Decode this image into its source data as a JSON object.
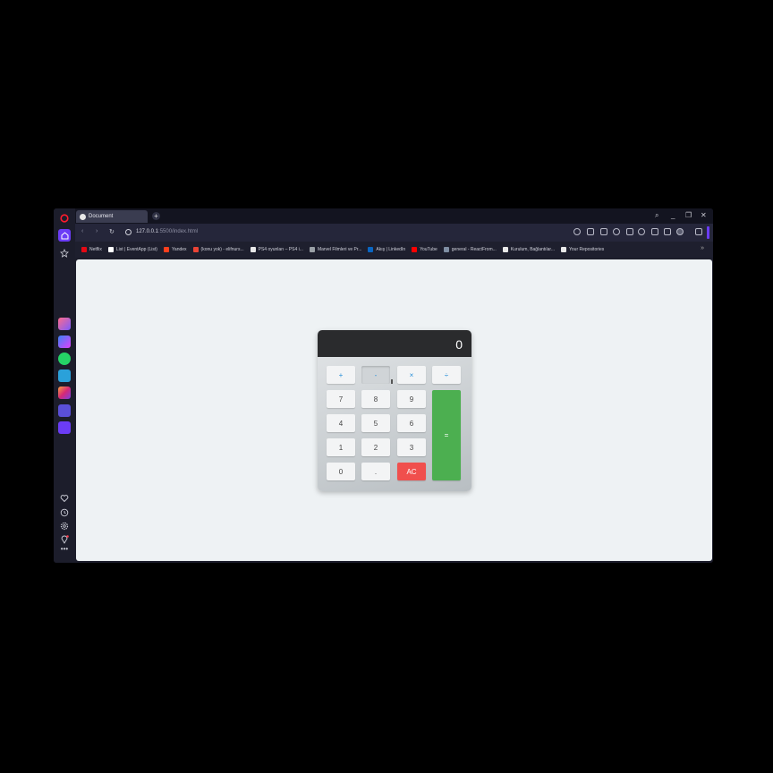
{
  "tab": {
    "title": "Document",
    "new_tab": "+"
  },
  "address": {
    "host": "127.0.0.1",
    "rest": ":5500/index.html"
  },
  "window_controls": {
    "search": "⌕",
    "minimize": "_",
    "restore": "❐",
    "close": "✕"
  },
  "nav": {
    "back": "‹",
    "forward": "›",
    "reload": "↻"
  },
  "bookmarks": [
    {
      "label": "Netflix",
      "color": "#e50914"
    },
    {
      "label": "List | EventApp (List)",
      "color": "#ffffff"
    },
    {
      "label": "Yandex",
      "color": "#fc3f1d"
    },
    {
      "label": "(konu yok) - elifnurs...",
      "color": "#ea4335"
    },
    {
      "label": "PS4 oyunları – PS4 i...",
      "color": "#e8e8e8"
    },
    {
      "label": "Marvel Filmleri ve Pr...",
      "color": "#9aa0a6"
    },
    {
      "label": "Akış | LinkedIn",
      "color": "#0a66c2"
    },
    {
      "label": "YouTube",
      "color": "#ff0000"
    },
    {
      "label": "general - ReactFrom...",
      "color": "#7f8ea3"
    },
    {
      "label": "Kurulum, Bağlantılar...",
      "color": "#e8e8e8"
    },
    {
      "label": "Your Repositories",
      "color": "#e8e8e8"
    }
  ],
  "bookmarks_more": "»",
  "calculator": {
    "display": "0",
    "ops": [
      "+",
      "-",
      "×",
      "÷"
    ],
    "digits": [
      "7",
      "8",
      "9",
      "4",
      "5",
      "6",
      "1",
      "2",
      "3",
      "0",
      "."
    ],
    "clear": "AC",
    "equals": "="
  },
  "colors": {
    "accent": "#6b3cf6",
    "equals": "#4caf50",
    "clear": "#f04f4d"
  },
  "sidebar_icons": [
    "opera-logo-icon",
    "home-icon",
    "star-icon",
    "aria-icon",
    "messenger-icon",
    "whatsapp-icon",
    "telegram-icon",
    "instagram-icon",
    "extensions-icon",
    "player-icon",
    "heart-icon",
    "history-icon",
    "settings-icon",
    "pin-icon",
    "more-icon"
  ]
}
